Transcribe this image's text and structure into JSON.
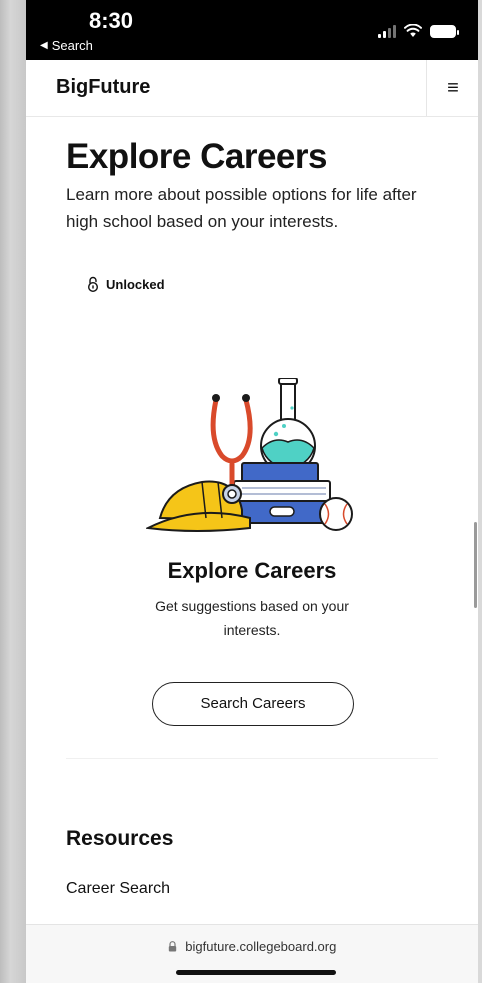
{
  "status_bar": {
    "time": "8:30",
    "back_label": "Search",
    "icons": [
      "signal-icon",
      "wifi-icon",
      "battery-icon"
    ]
  },
  "header": {
    "brand": "BigFuture",
    "menu_icon": "hamburger-menu-icon"
  },
  "hero": {
    "title": "Explore Careers",
    "subtitle": "Learn more about possible options for life after high school based on your interests."
  },
  "card": {
    "lock_status": "Unlocked",
    "lock_icon": "unlocked-padlock-icon",
    "illustration": "careers-illustration",
    "title": "Explore Careers",
    "description": "Get suggestions based on your interests.",
    "button_label": "Search Careers"
  },
  "resources": {
    "heading": "Resources",
    "links": [
      "Career Search"
    ]
  },
  "browser": {
    "url": "bigfuture.collegeboard.org"
  },
  "colors": {
    "status_bar": "#000000",
    "text": "#111111",
    "helmet": "#F5C518",
    "stethoscope": "#D94A2B",
    "books_blue": "#4169C8",
    "flask_liquid": "#4FD1C5"
  }
}
